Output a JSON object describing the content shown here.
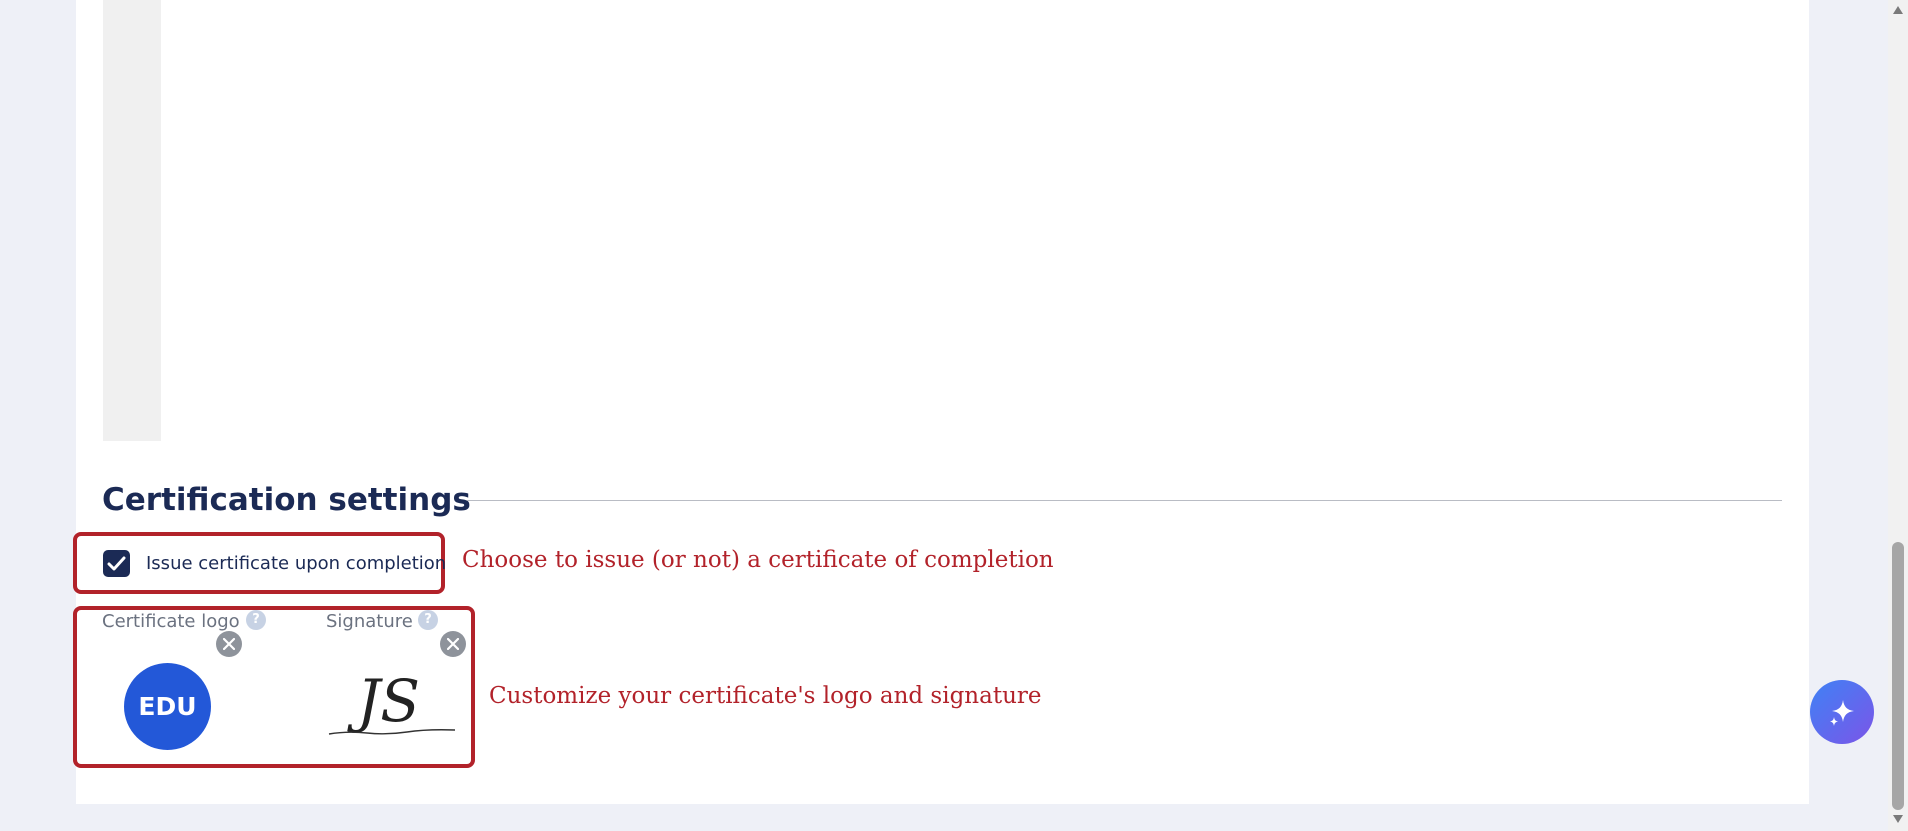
{
  "section": {
    "title": "Certification settings"
  },
  "issue_certificate": {
    "label": "Issue certificate upon completion",
    "checked": true
  },
  "fields": {
    "logo_label": "Certificate logo",
    "signature_label": "Signature",
    "help_glyph": "?",
    "logo_text": "EDU",
    "signature_text": "JS"
  },
  "annotations": {
    "checkbox_note": "Choose to issue (or not) a certificate of completion",
    "assets_note": "Customize your certificate's logo and signature"
  },
  "icons": {
    "check": "check-icon",
    "remove": "close-icon",
    "help": "question-icon",
    "assistant": "sparkle-icon"
  },
  "colors": {
    "brand_navy": "#1b2a55",
    "annotation_red": "#b2222a",
    "logo_blue": "#2358d8"
  }
}
